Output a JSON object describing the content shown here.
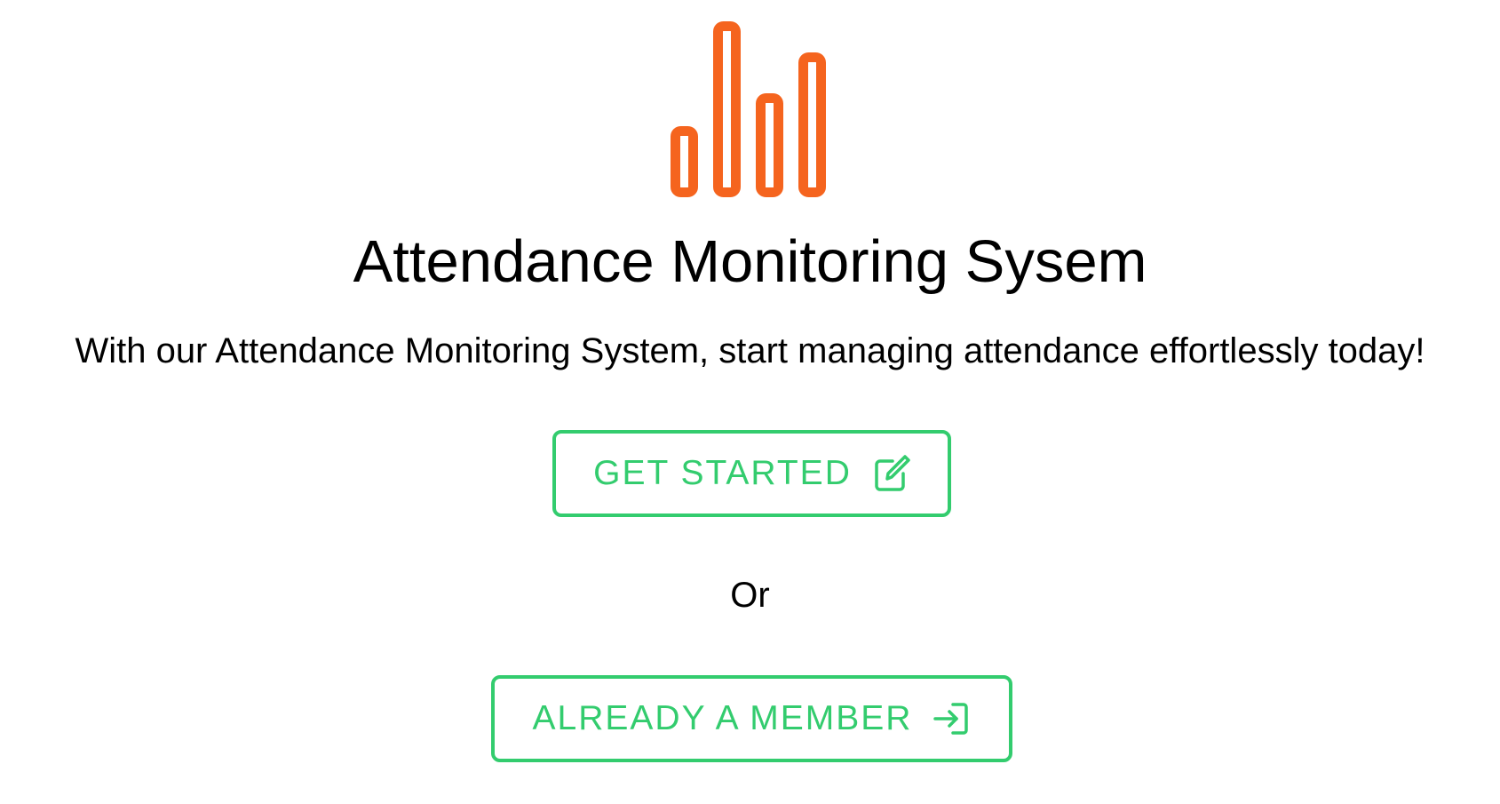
{
  "brand": {
    "logo_icon": "bar-chart-icon",
    "accent_color": "#f5641e"
  },
  "hero": {
    "title": "Attendance Monitoring Sysem",
    "subtitle": "With our Attendance Monitoring System, start managing attendance effortlessly today!"
  },
  "actions": {
    "get_started_label": "GET STARTED",
    "get_started_icon": "edit-icon",
    "separator": "Or",
    "member_label": "ALREADY A MEMBER",
    "member_icon": "sign-in-icon",
    "button_color": "#33cc6e"
  }
}
